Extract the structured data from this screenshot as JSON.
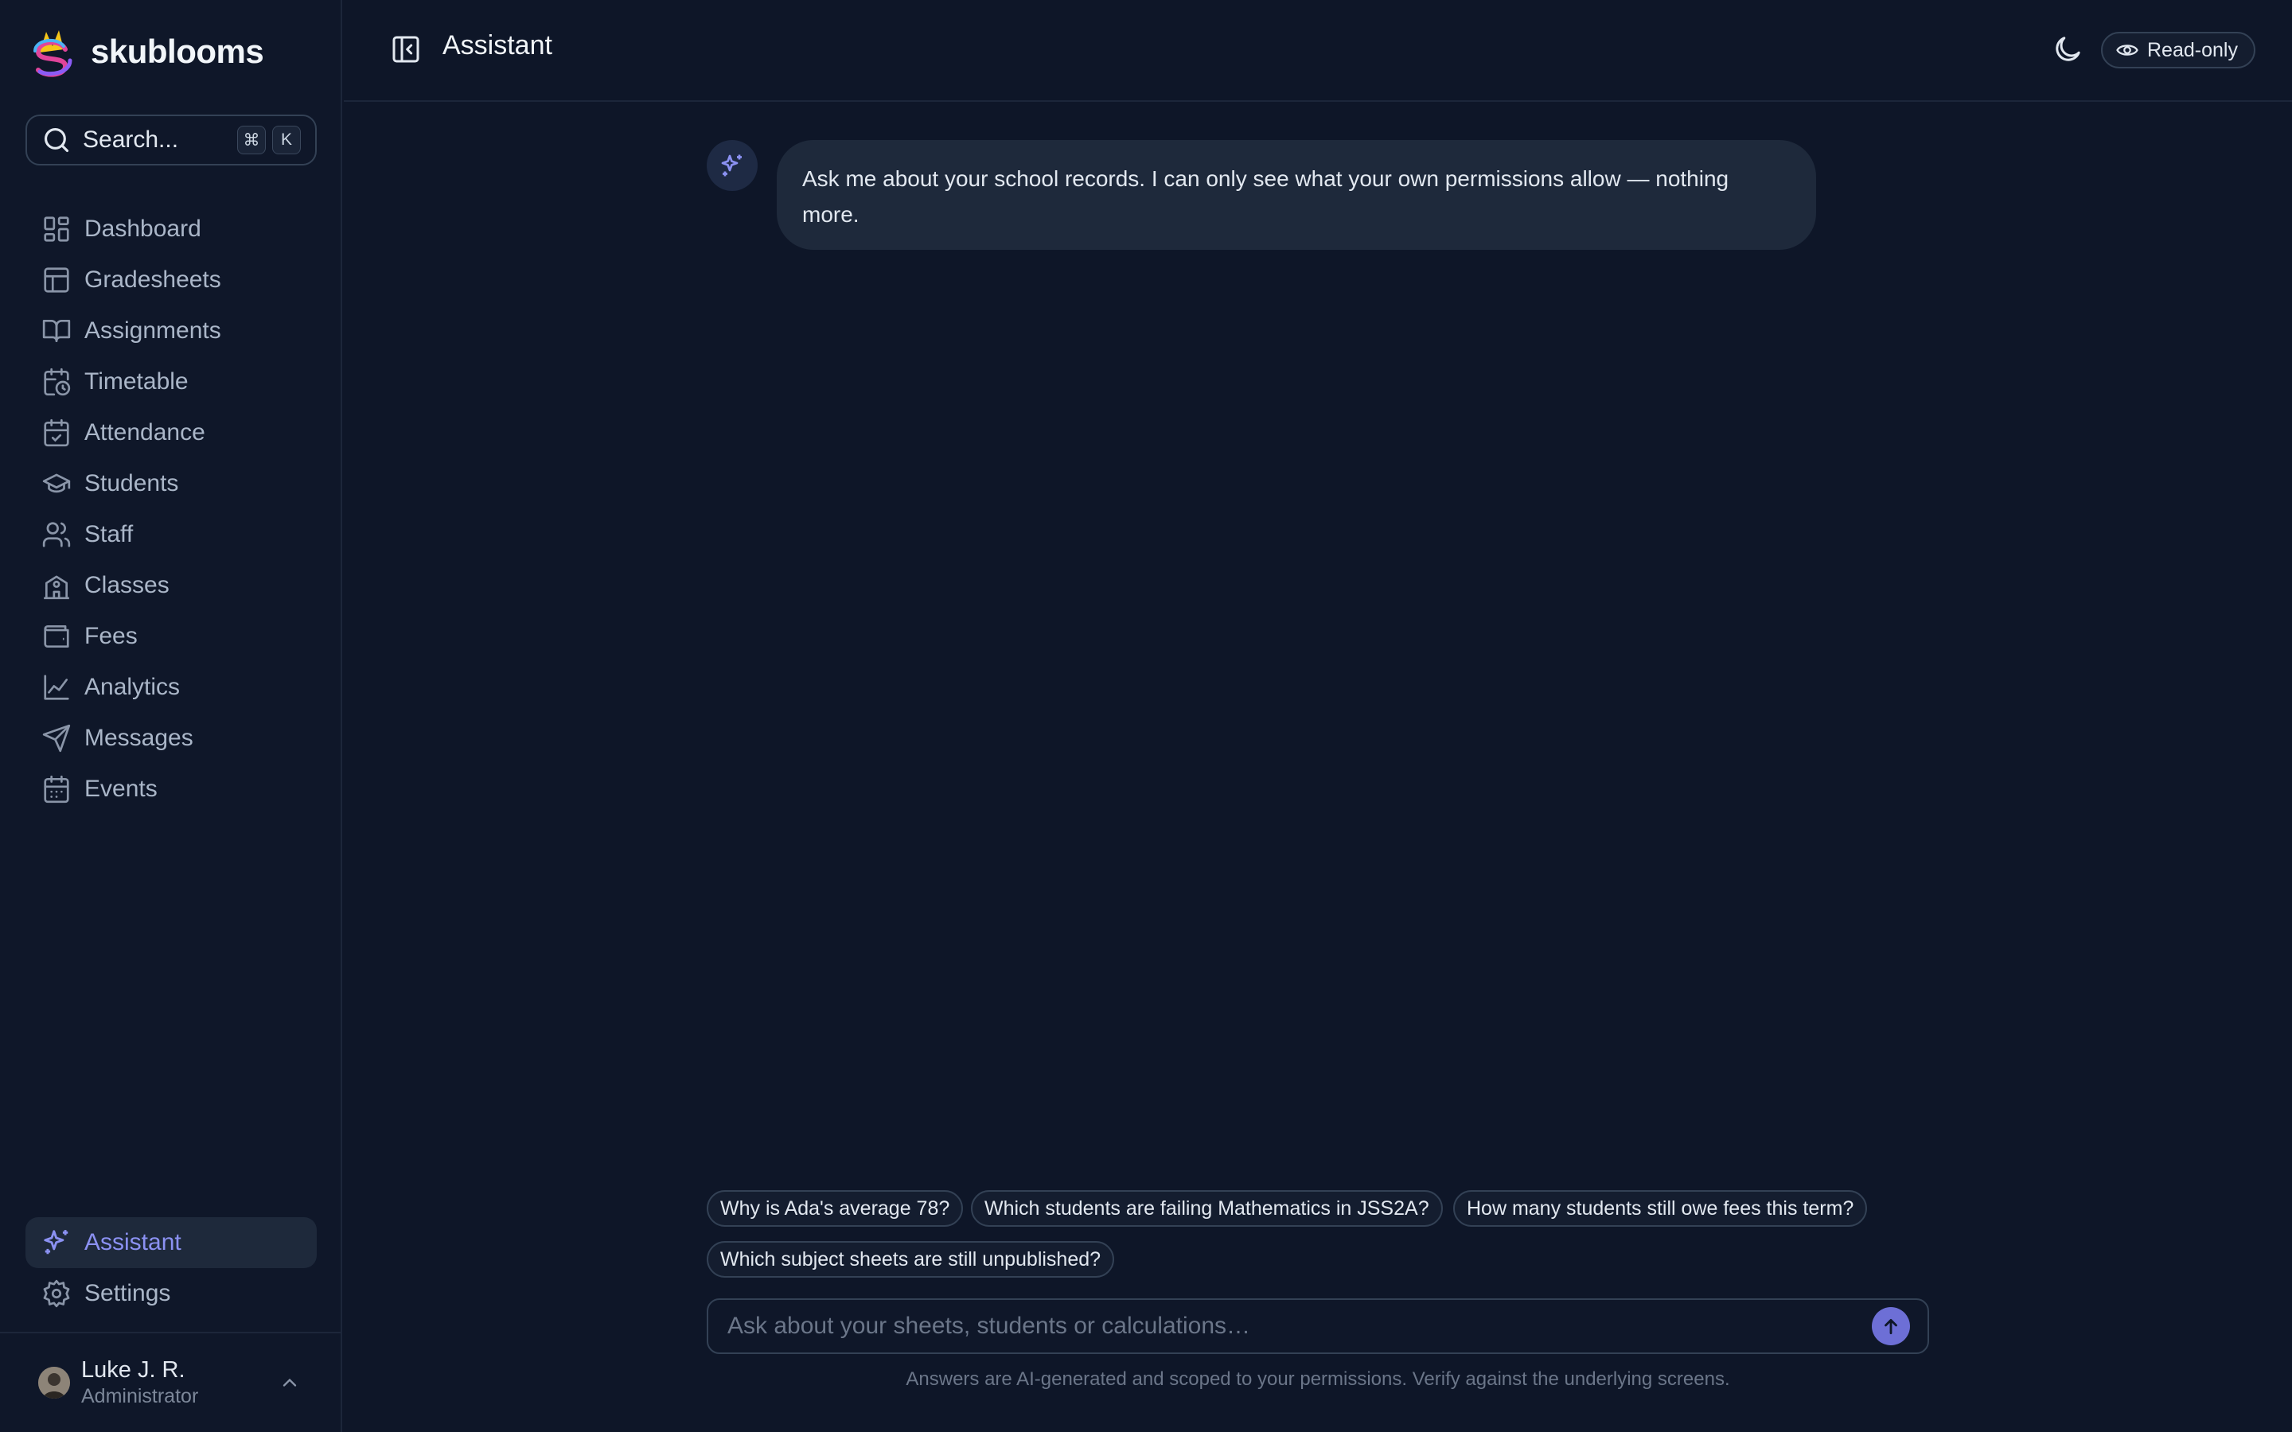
{
  "brand": {
    "name": "skublooms"
  },
  "search": {
    "placeholder": "Search...",
    "kbd_modifier": "⌘",
    "kbd_key": "K"
  },
  "sidebar": {
    "items": [
      {
        "label": "Dashboard",
        "icon": "dashboard-icon"
      },
      {
        "label": "Gradesheets",
        "icon": "table-icon"
      },
      {
        "label": "Assignments",
        "icon": "book-icon"
      },
      {
        "label": "Timetable",
        "icon": "calendar-clock-icon"
      },
      {
        "label": "Attendance",
        "icon": "calendar-check-icon"
      },
      {
        "label": "Students",
        "icon": "graduation-cap-icon"
      },
      {
        "label": "Staff",
        "icon": "users-icon"
      },
      {
        "label": "Classes",
        "icon": "school-icon"
      },
      {
        "label": "Fees",
        "icon": "wallet-icon"
      },
      {
        "label": "Analytics",
        "icon": "line-chart-icon"
      },
      {
        "label": "Messages",
        "icon": "send-icon"
      },
      {
        "label": "Events",
        "icon": "calendar-icon"
      }
    ],
    "bottom_items": [
      {
        "label": "Assistant",
        "icon": "sparkles-icon",
        "active": true
      },
      {
        "label": "Settings",
        "icon": "gear-icon",
        "active": false
      }
    ]
  },
  "user": {
    "name": "Luke J. R.",
    "role": "Administrator"
  },
  "header": {
    "title": "Assistant",
    "badge": "Read-only"
  },
  "chat": {
    "messages": [
      {
        "role": "assistant",
        "text": "Ask me about your school records. I can only see what your own permissions allow — nothing more."
      }
    ]
  },
  "suggestions": [
    "Why is Ada's average 78?",
    "Which students are failing Mathematics in JSS2A?",
    "How many students still owe fees this term?",
    "Which subject sheets are still unpublished?"
  ],
  "composer": {
    "placeholder": "Ask about your sheets, students or calculations…",
    "value": ""
  },
  "disclaimer": "Answers are AI-generated and scoped to your permissions. Verify against the underlying screens.",
  "colors": {
    "accent": "#8b91f2",
    "send": "#6d6fd6",
    "background": "#0e1628",
    "bubble": "#1e293b"
  }
}
